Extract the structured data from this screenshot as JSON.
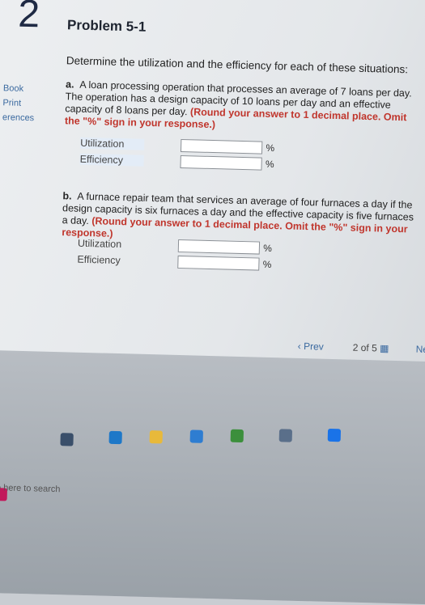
{
  "question_number": "2",
  "left_strip": [
    "Book",
    "Print",
    "erences"
  ],
  "problem": {
    "title": "Problem 5-1",
    "intro": "Determine the utilization and the efficiency for each of these situations:",
    "part_a": {
      "letter": "a.",
      "text": "A loan processing operation that processes an average of 7 loans per day. The operation has a design capacity of 10 loans per day and an effective capacity of 8 loans per day.",
      "instruction": "(Round your answer to 1 decimal place. Omit the \"%\" sign in your response.)",
      "rows": [
        {
          "label": "Utilization",
          "unit": "%"
        },
        {
          "label": "Efficiency",
          "unit": "%"
        }
      ]
    },
    "part_b": {
      "letter": "b.",
      "text": "A furnace repair team that services an average of four furnaces a day if the design capacity is six furnaces a day and the effective capacity is five furnaces a day.",
      "instruction": "(Round your answer to 1 decimal place. Omit the \"%\" sign in your response.)",
      "rows": [
        {
          "label": "Utilization",
          "unit": "%"
        },
        {
          "label": "Efficiency",
          "unit": "%"
        }
      ]
    }
  },
  "navigation": {
    "prev_label": "Prev",
    "page_current": "2",
    "page_of": "of",
    "page_total": "5",
    "next_label": "Next"
  },
  "taskbar": {
    "search_hint": "e here to search"
  },
  "colors": {
    "accent": "#3b6aa0",
    "instruction_red": "#c0352c"
  }
}
